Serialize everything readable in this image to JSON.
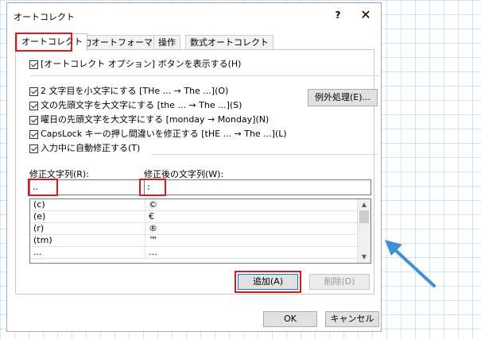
{
  "window": {
    "title": "オートコレクト",
    "help": "?",
    "close": "✕"
  },
  "tabs": [
    "オートコレクト",
    "入力オートフォーマット",
    "操作",
    "数式オートコレクト"
  ],
  "options": {
    "show_buttons": "[オートコレクト オプション] ボタンを表示する(H)",
    "two_initial_caps": "2 文字目を小文字にする [THe ... → The ...](O)",
    "capitalize_sentence": "文の先頭文字を大文字にする [the ... → The ...](S)",
    "capitalize_days": "曜日の先頭文字を大文字にする [monday → Monday](N)",
    "caps_lock": "CapsLock キーの押し間違いを修正する [tHE ... → The ...](L)",
    "replace_as_type": "入力中に自動修正する(T)"
  },
  "buttons": {
    "exceptions": "例外処理(E)...",
    "add": "追加(A)",
    "delete": "削除(D)",
    "ok": "OK",
    "cancel": "キャンセル"
  },
  "fields": {
    "replace_label": "修正文字列(R):",
    "with_label": "修正後の文字列(W):",
    "replace_value": "..",
    "with_value": ":"
  },
  "list": [
    {
      "replace": "(c)",
      "with": "©"
    },
    {
      "replace": "(e)",
      "with": "€"
    },
    {
      "replace": "(r)",
      "with": "®"
    },
    {
      "replace": "(tm)",
      "with": "™"
    },
    {
      "replace": "...",
      "with": "…"
    }
  ],
  "colors": {
    "highlight": "#e8141b",
    "arrow": "#3d8fd6",
    "accent_border": "#0078d7"
  },
  "icons": {
    "scroll_up": "▲",
    "scroll_down": "▼"
  }
}
